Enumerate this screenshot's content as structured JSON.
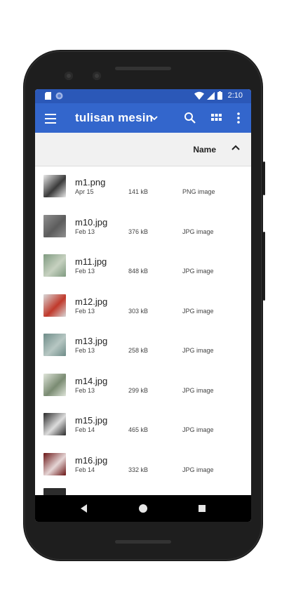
{
  "status_bar": {
    "time": "2:10",
    "left_icons": [
      "sd-card-icon",
      "sync-icon"
    ],
    "right_icons": [
      "wifi-icon",
      "signal-icon",
      "battery-icon"
    ]
  },
  "app_bar": {
    "title": "tulisan mesin",
    "color": "#3366cc"
  },
  "sort_bar": {
    "label": "Name",
    "direction": "ascending"
  },
  "files": [
    {
      "name": "m1.png",
      "date": "Apr 15",
      "size": "141 kB",
      "type": "PNG image",
      "thumb": [
        "#e9e9e9",
        "#3a3a3a"
      ]
    },
    {
      "name": "m10.jpg",
      "date": "Feb 13",
      "size": "376 kB",
      "type": "JPG image",
      "thumb": [
        "#8f8f8f",
        "#5c5c5c"
      ]
    },
    {
      "name": "m11.jpg",
      "date": "Feb 13",
      "size": "848 kB",
      "type": "JPG image",
      "thumb": [
        "#7f9a80",
        "#c6d1c0"
      ]
    },
    {
      "name": "m12.jpg",
      "date": "Feb 13",
      "size": "303 kB",
      "type": "JPG image",
      "thumb": [
        "#d8d8d8",
        "#c0392b"
      ]
    },
    {
      "name": "m13.jpg",
      "date": "Feb 13",
      "size": "258 kB",
      "type": "JPG image",
      "thumb": [
        "#6e8c88",
        "#b7c7c3"
      ]
    },
    {
      "name": "m14.jpg",
      "date": "Feb 13",
      "size": "299 kB",
      "type": "JPG image",
      "thumb": [
        "#dfe5da",
        "#7a8b72"
      ]
    },
    {
      "name": "m15.jpg",
      "date": "Feb 14",
      "size": "465 kB",
      "type": "JPG image",
      "thumb": [
        "#2a2a2a",
        "#dcdcdc"
      ]
    },
    {
      "name": "m16.jpg",
      "date": "Feb 14",
      "size": "332 kB",
      "type": "JPG image",
      "thumb": [
        "#6a1515",
        "#e5d5d5"
      ]
    }
  ]
}
